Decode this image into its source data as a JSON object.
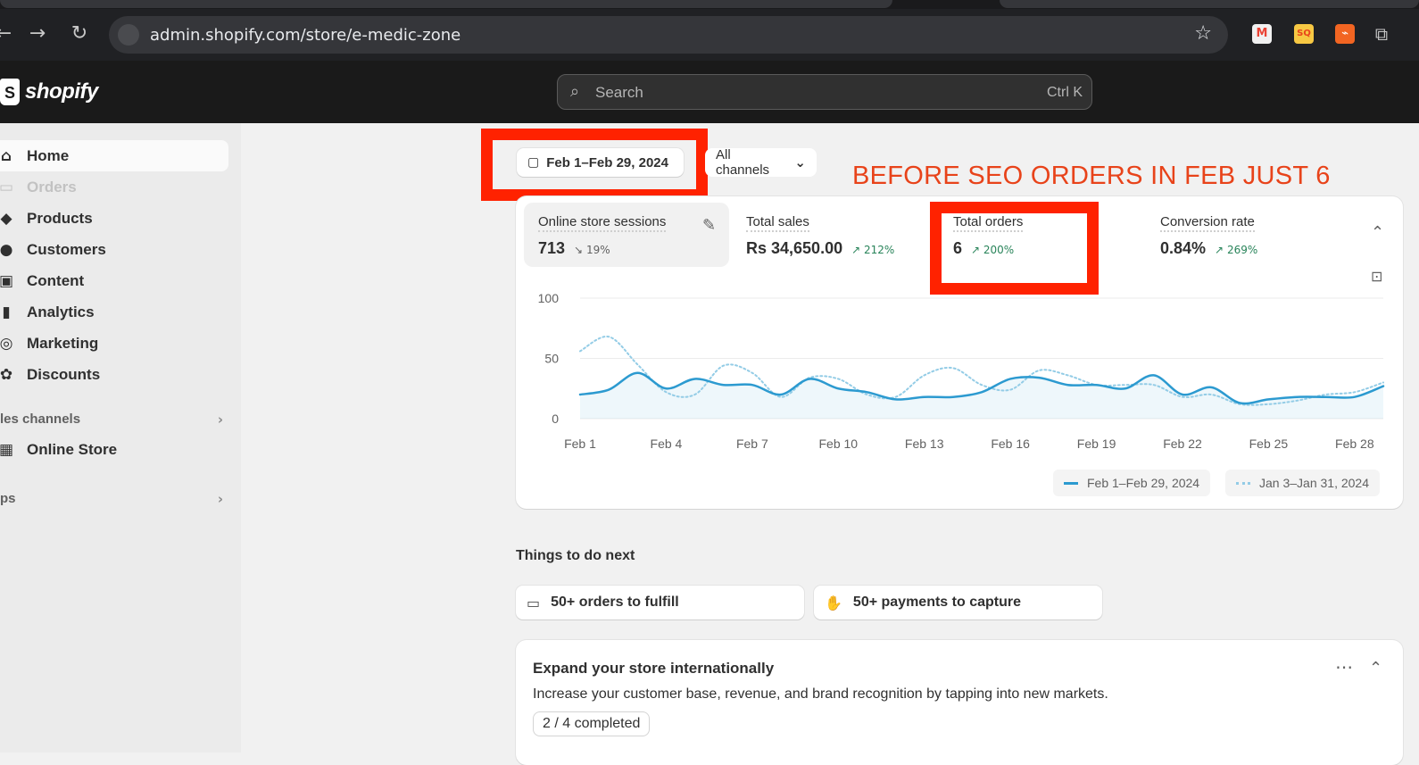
{
  "browser": {
    "url": "admin.shopify.com/store/e-medic-zone",
    "back_icon": "back-arrow-icon",
    "forward_icon": "forward-arrow-icon",
    "reload_icon": "reload-icon",
    "bookmark_icon": "star-icon",
    "extensions": [
      {
        "name": "gmail-extension-icon",
        "glyph": "M",
        "color": "#ea4335",
        "bg": "#f1f1f1"
      },
      {
        "name": "sq-extension-icon",
        "glyph": "SQ",
        "color": "#e8431a",
        "bg": "#f7c843"
      },
      {
        "name": "rss-extension-icon",
        "glyph": "⌁",
        "color": "#ffffff",
        "bg": "#f26522"
      }
    ]
  },
  "header": {
    "logo_text": "shopify",
    "search_placeholder": "Search",
    "search_shortcut": "Ctrl K"
  },
  "sidebar": {
    "items": [
      {
        "label": "Home",
        "icon": "home-icon",
        "glyph": "⌂"
      },
      {
        "label": "Orders",
        "icon": "inbox-icon",
        "glyph": "▭"
      },
      {
        "label": "Products",
        "icon": "tag-icon",
        "glyph": "◆"
      },
      {
        "label": "Customers",
        "icon": "person-icon",
        "glyph": "●"
      },
      {
        "label": "Content",
        "icon": "image-icon",
        "glyph": "▣"
      },
      {
        "label": "Analytics",
        "icon": "bar-chart-icon",
        "glyph": "▮"
      },
      {
        "label": "Marketing",
        "icon": "target-icon",
        "glyph": "◎"
      },
      {
        "label": "Discounts",
        "icon": "discount-icon",
        "glyph": "✿"
      }
    ],
    "sales_channels_label": "les channels",
    "online_store_label": "Online Store",
    "online_store_icon": "store-icon",
    "apps_label": "ps"
  },
  "filters": {
    "date_range": "Feb 1–Feb 29, 2024",
    "channels": "All channels"
  },
  "annotation": "BEFORE SEO ORDERS IN  FEB JUST 6",
  "metrics": [
    {
      "label": "Online store sessions",
      "value": "713",
      "change": "19%",
      "direction": "down"
    },
    {
      "label": "Total sales",
      "value": "Rs 34,650.00",
      "change": "212%",
      "direction": "up"
    },
    {
      "label": "Total orders",
      "value": "6",
      "change": "200%",
      "direction": "up"
    },
    {
      "label": "Conversion rate",
      "value": "0.84%",
      "change": "269%",
      "direction": "up"
    }
  ],
  "chart_data": {
    "type": "line",
    "x": [
      "Feb 1",
      "Feb 2",
      "Feb 3",
      "Feb 4",
      "Feb 5",
      "Feb 6",
      "Feb 7",
      "Feb 8",
      "Feb 9",
      "Feb 10",
      "Feb 11",
      "Feb 12",
      "Feb 13",
      "Feb 14",
      "Feb 15",
      "Feb 16",
      "Feb 17",
      "Feb 18",
      "Feb 19",
      "Feb 20",
      "Feb 21",
      "Feb 22",
      "Feb 23",
      "Feb 24",
      "Feb 25",
      "Feb 26",
      "Feb 27",
      "Feb 28",
      "Feb 29"
    ],
    "x_tick_labels": [
      "Feb 1",
      "Feb 4",
      "Feb 7",
      "Feb 10",
      "Feb 13",
      "Feb 16",
      "Feb 19",
      "Feb 22",
      "Feb 25",
      "Feb 28"
    ],
    "y_tick_labels": [
      "100",
      "50",
      "0"
    ],
    "ylim": [
      0,
      100
    ],
    "series": [
      {
        "name": "Feb 1–Feb 29, 2024",
        "style": "solid",
        "color": "#2c9ad0",
        "values": [
          20,
          24,
          38,
          25,
          33,
          28,
          28,
          20,
          33,
          25,
          22,
          16,
          18,
          18,
          22,
          33,
          34,
          28,
          28,
          25,
          36,
          20,
          26,
          13,
          16,
          18,
          18,
          18,
          27
        ]
      },
      {
        "name": "Jan 3–Jan 31, 2024",
        "style": "dotted",
        "color": "#93cce6",
        "values": [
          56,
          68,
          45,
          22,
          20,
          44,
          38,
          18,
          34,
          33,
          20,
          18,
          36,
          42,
          28,
          24,
          40,
          36,
          28,
          28,
          28,
          18,
          20,
          12,
          12,
          15,
          20,
          22,
          30
        ]
      }
    ]
  },
  "chart_icons": {
    "collapse": "chevron-up-icon",
    "report": "report-icon"
  },
  "things_to_do": {
    "heading": "Things to do next",
    "tasks": [
      {
        "label": "50+ orders to fulfill",
        "icon": "inbox-icon",
        "glyph": "▭"
      },
      {
        "label": "50+ payments to capture",
        "icon": "payment-icon",
        "glyph": "✋"
      }
    ]
  },
  "expand_card": {
    "title": "Expand your store internationally",
    "description": "Increase your customer base, revenue, and brand recognition by tapping into new markets.",
    "progress": "2 / 4 completed"
  },
  "colors": {
    "annotation_red": "#ff2200",
    "growth_green": "#29845a",
    "series_primary": "#2c9ad0"
  }
}
